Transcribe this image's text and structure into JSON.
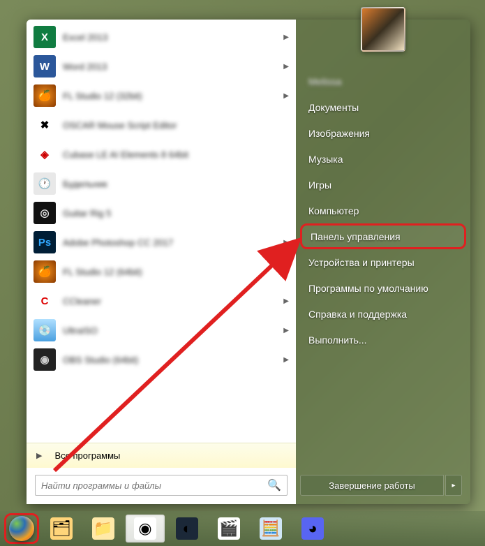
{
  "start_menu": {
    "programs": [
      {
        "label": "Excel 2013",
        "icon_bg": "#107c41",
        "icon_text": "X",
        "icon_color": "#fff",
        "has_chevron": true
      },
      {
        "label": "Word 2013",
        "icon_bg": "#2b579a",
        "icon_text": "W",
        "icon_color": "#fff",
        "has_chevron": true
      },
      {
        "label": "FL Studio 12 (32bit)",
        "icon_bg": "radial-gradient(#f7941e,#8a3a00)",
        "icon_text": "🍊",
        "icon_color": "#fff",
        "has_chevron": true
      },
      {
        "label": "OSCAR Mouse Script Editor",
        "icon_bg": "#fff",
        "icon_text": "✖",
        "icon_color": "#000",
        "has_chevron": false
      },
      {
        "label": "Cubase LE AI Elements 8 64bit",
        "icon_bg": "#fff",
        "icon_text": "◈",
        "icon_color": "#c00",
        "has_chevron": false
      },
      {
        "label": "Будильник",
        "icon_bg": "#e8e8e8",
        "icon_text": "🕐",
        "icon_color": "#555",
        "has_chevron": false
      },
      {
        "label": "Guitar Rig 5",
        "icon_bg": "#111",
        "icon_text": "◎",
        "icon_color": "#ddd",
        "has_chevron": false
      },
      {
        "label": "Adobe Photoshop CC 2017",
        "icon_bg": "#001e36",
        "icon_text": "Ps",
        "icon_color": "#31a8ff",
        "has_chevron": true
      },
      {
        "label": "FL Studio 12 (64bit)",
        "icon_bg": "radial-gradient(#f7941e,#8a3a00)",
        "icon_text": "🍊",
        "icon_color": "#fff",
        "has_chevron": true
      },
      {
        "label": "CCleaner",
        "icon_bg": "#fff",
        "icon_text": "C",
        "icon_color": "#d00",
        "has_chevron": true
      },
      {
        "label": "UltraISO",
        "icon_bg": "linear-gradient(#b0e0ff,#4aa0e0)",
        "icon_text": "💿",
        "icon_color": "#fff",
        "has_chevron": true
      },
      {
        "label": "OBS Studio (64bit)",
        "icon_bg": "#222",
        "icon_text": "◉",
        "icon_color": "#ccc",
        "has_chevron": true
      }
    ],
    "all_programs_label": "Все программы",
    "search_placeholder": "Найти программы и файлы"
  },
  "right_menu": {
    "username": "Melissa",
    "items": [
      {
        "label": "Документы",
        "highlighted": false
      },
      {
        "label": "Изображения",
        "highlighted": false
      },
      {
        "label": "Музыка",
        "highlighted": false
      },
      {
        "label": "Игры",
        "highlighted": false
      },
      {
        "label": "Компьютер",
        "highlighted": false
      },
      {
        "label": "Панель управления",
        "highlighted": true
      },
      {
        "label": "Устройства и принтеры",
        "highlighted": false
      },
      {
        "label": "Программы по умолчанию",
        "highlighted": false
      },
      {
        "label": "Справка и поддержка",
        "highlighted": false
      },
      {
        "label": "Выполнить...",
        "highlighted": false
      }
    ],
    "shutdown_label": "Завершение работы"
  },
  "taskbar": {
    "items": [
      {
        "name": "explorer",
        "icon": "🗂",
        "bg": "#ffd57a",
        "active": false
      },
      {
        "name": "folder",
        "icon": "📁",
        "bg": "#ffe9a8",
        "active": false
      },
      {
        "name": "chrome",
        "icon": "◉",
        "bg": "#fff",
        "active": true
      },
      {
        "name": "steam",
        "icon": "◐",
        "bg": "#1b2838",
        "active": false
      },
      {
        "name": "mpc",
        "icon": "🎬",
        "bg": "#fff",
        "active": false
      },
      {
        "name": "calculator",
        "icon": "🧮",
        "bg": "#d0e6f7",
        "active": false
      },
      {
        "name": "discord",
        "icon": "◕",
        "bg": "#5865f2",
        "active": false
      }
    ]
  }
}
